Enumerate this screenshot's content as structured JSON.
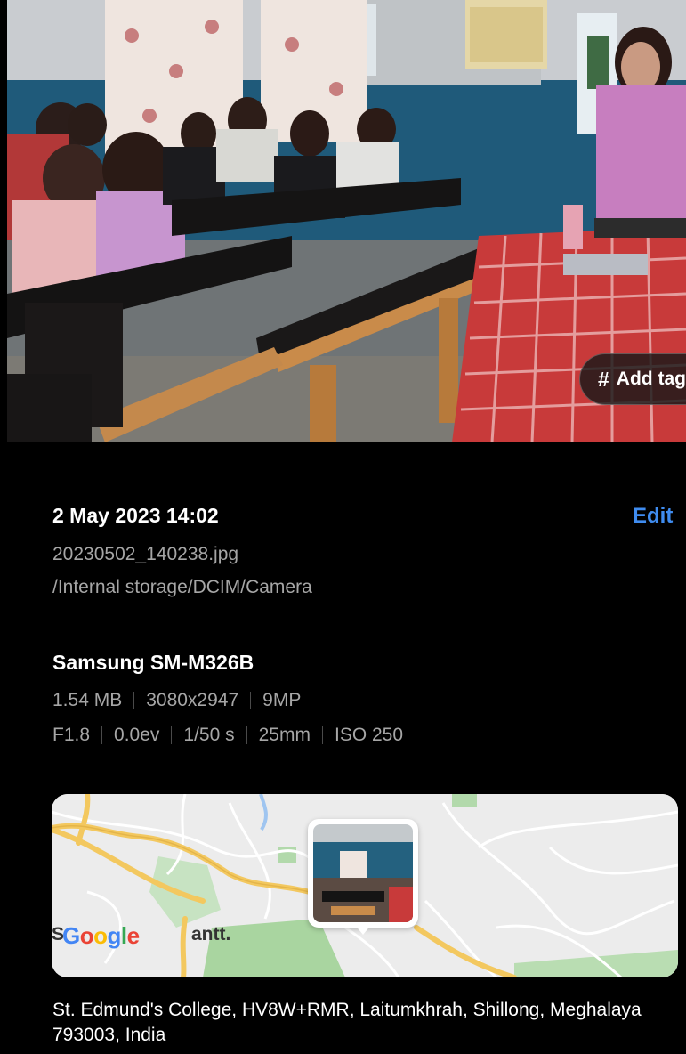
{
  "photo": {
    "add_tag_label": "Add tag"
  },
  "details": {
    "date_time": "2 May 2023 14:02",
    "edit_label": "Edit",
    "filename": "20230502_140238.jpg",
    "path": "/Internal storage/DCIM/Camera"
  },
  "camera": {
    "device": "Samsung SM-M326B",
    "row1": [
      "1.54 MB",
      "3080x2947",
      "9MP"
    ],
    "row2": [
      "F1.8",
      "0.0ev",
      "1/50 s",
      "25mm",
      "ISO 250"
    ]
  },
  "map": {
    "logo_text": "Google",
    "label_left": "S",
    "label_right": "antt."
  },
  "location": {
    "address": "St. Edmund's College, HV8W+RMR, Laitumkhrah, Shillong, Meghalaya 793003, India"
  },
  "colors": {
    "accent": "#3f8cf0",
    "background": "#000000",
    "secondary_text": "#a6a6a6"
  }
}
